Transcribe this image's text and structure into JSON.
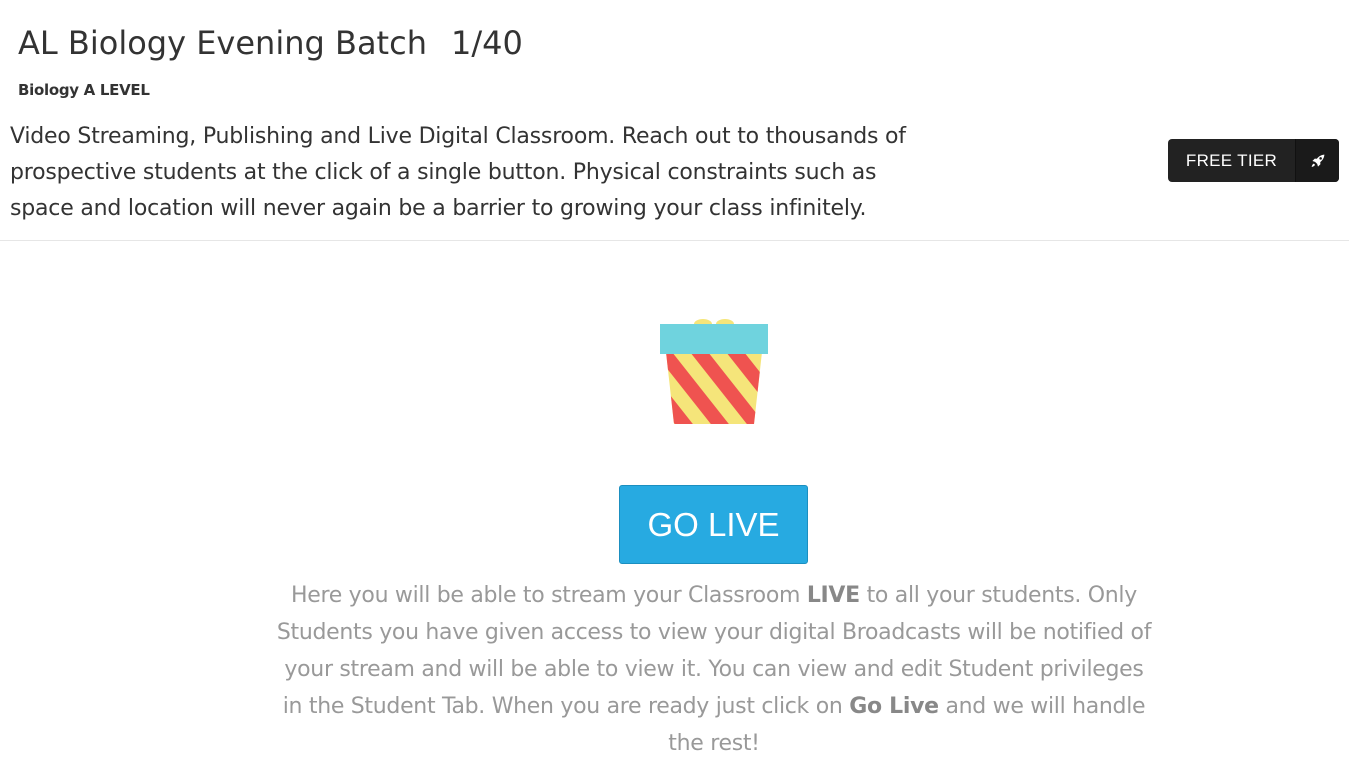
{
  "header": {
    "title": "AL Biology Evening Batch",
    "count": "1/40",
    "subject": "Biology A LEVEL",
    "description": "Video Streaming, Publishing and Live Digital Classroom. Reach out to thousands of prospective students at the click of a single button. Physical constraints such as space and location will never again be a barrier to growing your class infinitely.",
    "tier_label": "FREE TIER",
    "tier_icon": "rocket-icon"
  },
  "main": {
    "illustration": "gift-icon",
    "go_live_label": "GO LIVE",
    "info": {
      "part1": "Here you will be able to stream your Classroom ",
      "bold1": "LIVE",
      "part2": " to all your students. Only Students you have given access to view your digital Broadcasts will be notified of your stream and will be able to view it. You can view and edit Student privileges in the Student Tab. When you are ready just click on ",
      "bold2": "Go Live",
      "part3": " and we will handle the rest!"
    }
  },
  "colors": {
    "accent": "#27aae1",
    "badge_bg": "#222222",
    "gift_lid": "#6fd3de",
    "gift_stripe_red": "#ef5350",
    "gift_stripe_yellow": "#f5e57a"
  }
}
